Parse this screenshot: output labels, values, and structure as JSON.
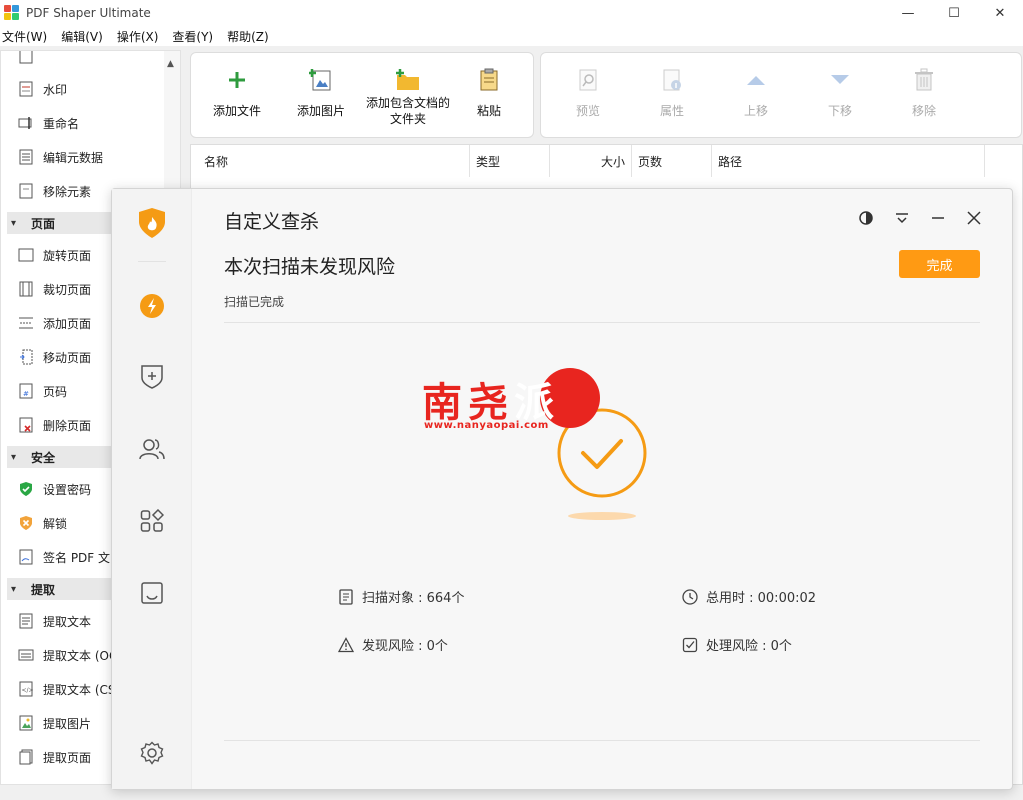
{
  "window": {
    "title": "PDF Shaper Ultimate",
    "controls": {
      "minimize": "—",
      "maximize": "☐",
      "close": "✕"
    }
  },
  "menu": [
    "文件(W)",
    "编辑(V)",
    "操作(X)",
    "查看(Y)",
    "帮助(Z)"
  ],
  "left_panel": {
    "items_top": [
      "水印",
      "重命名",
      "编辑元数据",
      "移除元素"
    ],
    "groups": [
      {
        "label": "页面",
        "items": [
          "旋转页面",
          "裁切页面",
          "添加页面",
          "移动页面",
          "页码",
          "删除页面"
        ]
      },
      {
        "label": "安全",
        "items": [
          "设置密码",
          "解锁",
          "签名 PDF 文"
        ]
      },
      {
        "label": "提取",
        "items": [
          "提取文本",
          "提取文本 (OC",
          "提取文本 (CS",
          "提取图片",
          "提取页面"
        ]
      }
    ]
  },
  "toolbar": {
    "group1": [
      "添加文件",
      "添加图片",
      "添加包含文档的文件夹",
      "粘贴"
    ],
    "group2": [
      "预览",
      "属性",
      "上移",
      "下移",
      "移除"
    ]
  },
  "file_list": {
    "columns": [
      "名称",
      "类型",
      "大小",
      "页数",
      "路径"
    ]
  },
  "dialog": {
    "title": "自定义查杀",
    "heading": "本次扫描未发现风险",
    "status": "扫描已完成",
    "done_button": "完成",
    "stats": {
      "scanned": "扫描对象 : 664个",
      "time": "总用时 : 00:00:02",
      "risks_found": "发现风险 : 0个",
      "risks_handled": "处理风险 : 0个"
    },
    "accent_color": "#ff9a13"
  },
  "watermark": {
    "text": "南尧派",
    "url": "www.nanyaopai.com",
    "color": "#e8251f"
  }
}
